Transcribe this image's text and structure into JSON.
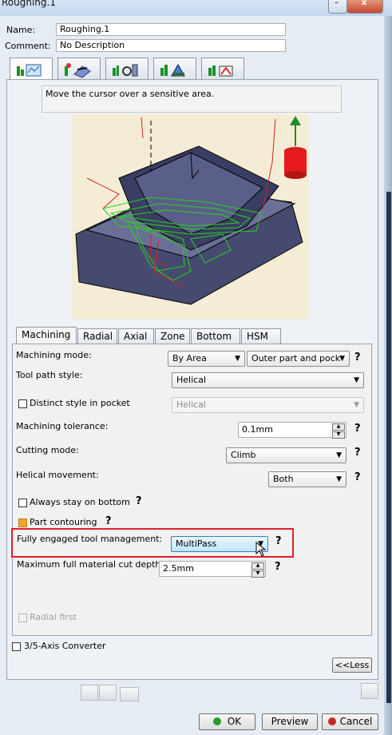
{
  "window": {
    "title": "Roughing.1",
    "min_glyph": "–",
    "close_glyph": "x"
  },
  "header": {
    "name_label": "Name:",
    "name_value": "Roughing.1",
    "comment_label": "Comment:",
    "comment_value": "No Description"
  },
  "icon_tabs": [
    "strategy-tab-icon",
    "geometry-tab-icon",
    "tool-tab-icon",
    "feeds-speeds-tab-icon",
    "macros-tab-icon"
  ],
  "hint": "Move the cursor over a sensitive area.",
  "subtabs": [
    "Machining",
    "Radial",
    "Axial",
    "Zone",
    "Bottom",
    "HSM"
  ],
  "form": {
    "machining_mode_label": "Machining mode:",
    "machining_mode_value": "By Area",
    "machining_mode_value2": "Outer part and pock",
    "tool_path_style_label": "Tool path style:",
    "tool_path_style_value": "Helical",
    "distinct_style_label": "Distinct style in pocket",
    "distinct_style_value": "Helical",
    "tolerance_label": "Machining tolerance:",
    "tolerance_value": "0.1mm",
    "cutting_mode_label": "Cutting mode:",
    "cutting_mode_value": "Climb",
    "helical_label": "Helical movement:",
    "helical_value": "Both",
    "always_bottom_label": "Always stay on bottom",
    "part_contouring_label": "Part contouring",
    "fully_engaged_label": "Fully engaged tool management:",
    "fully_engaged_value": "MultiPass",
    "max_cut_label": "Maximum full material cut depth:",
    "max_cut_value": "2.5mm",
    "radial_first_label": "Radial first",
    "qmark": "?"
  },
  "converter_label": "3/5-Axis Converter",
  "less_button": "<<Less",
  "footer": {
    "ok": "OK",
    "preview": "Preview",
    "cancel": "Cancel",
    "green": "#2a9d2a",
    "red": "#c62828"
  }
}
